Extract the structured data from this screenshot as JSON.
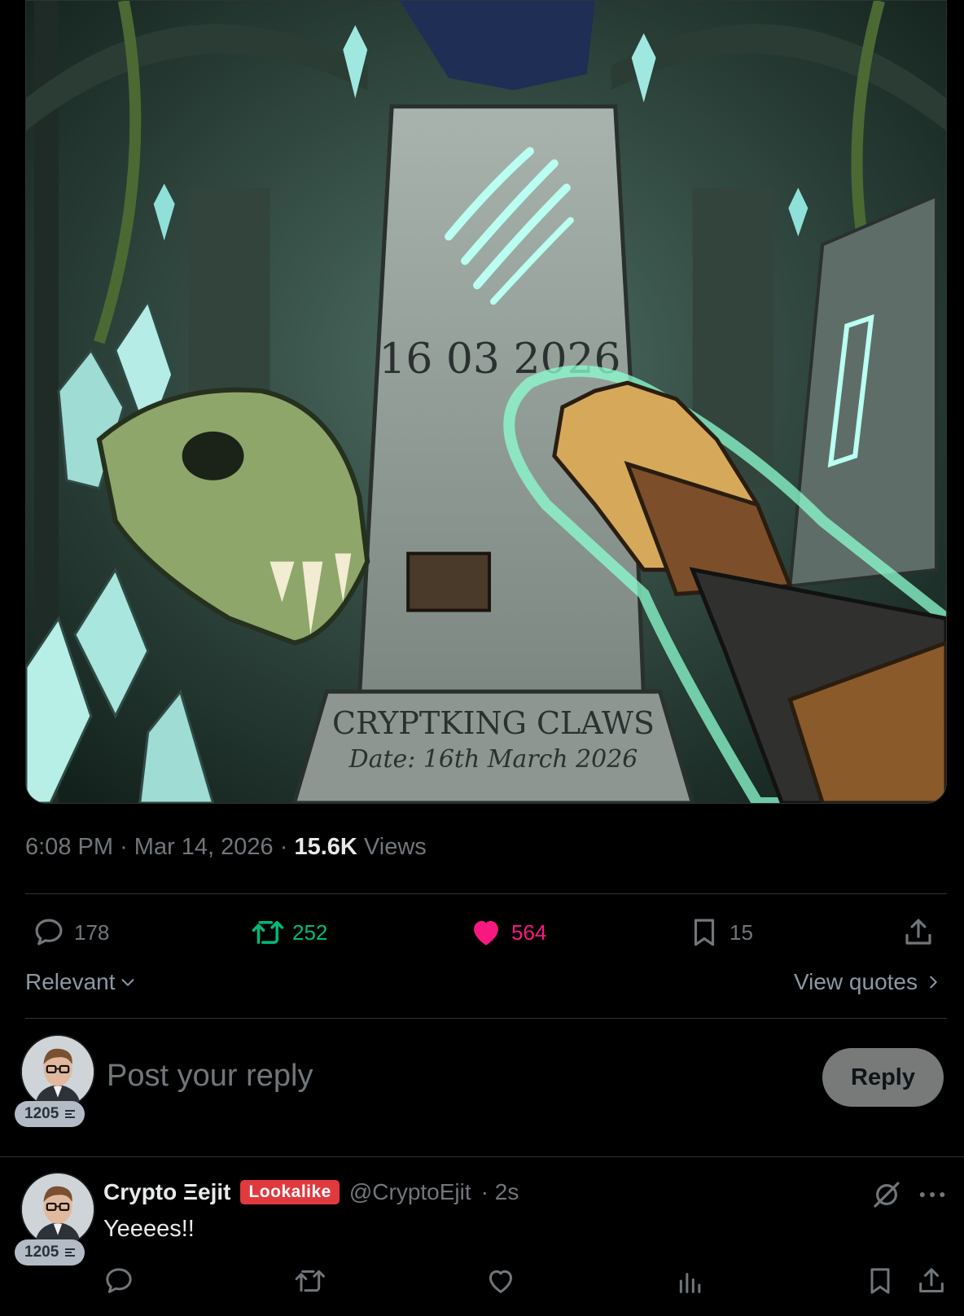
{
  "media": {
    "engraved_date": "16 03 2026",
    "plaque_title": "CRYPTKING CLAWS",
    "plaque_subtitle": "Date: 16th March 2026"
  },
  "meta": {
    "time": "6:08 PM",
    "separator": "·",
    "date": "Mar 14, 2026",
    "views_count": "15.6K",
    "views_label": "Views"
  },
  "actions": {
    "replies": "178",
    "retweets": "252",
    "likes": "564",
    "bookmarks": "15"
  },
  "sort": {
    "label": "Relevant",
    "view_quotes": "View quotes"
  },
  "composer": {
    "placeholder": "Post your reply",
    "reply_button": "Reply",
    "level": "1205"
  },
  "reply": {
    "display_name": "Crypto Ξejit",
    "badge": "Lookalike",
    "handle": "@CryptoEjit",
    "time": "· 2s",
    "text": "Yeeees!!",
    "level": "1205"
  },
  "colors": {
    "background": "#000000",
    "text_secondary": "#71767b",
    "retweet_green": "#00ba7c",
    "like_pink": "#f91880",
    "lookalike_red": "#e0393e",
    "reply_button": "#787a7a"
  }
}
